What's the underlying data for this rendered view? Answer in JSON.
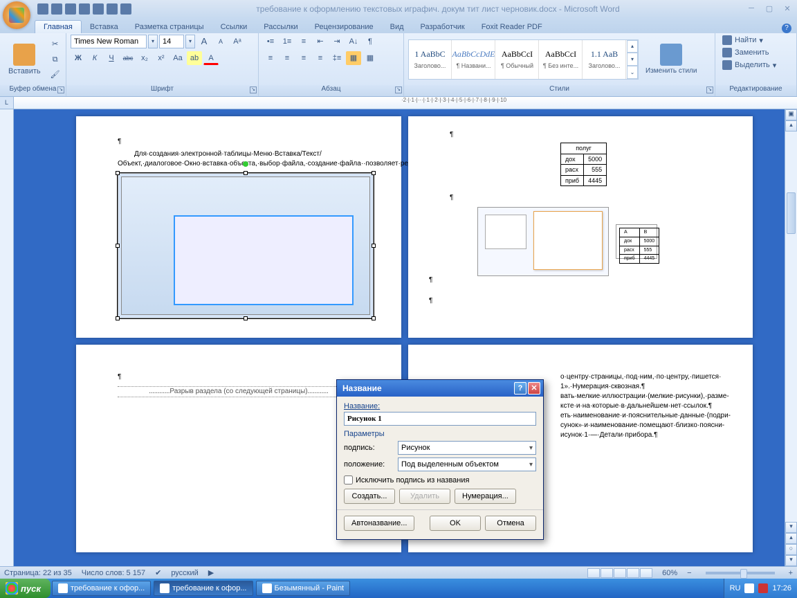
{
  "titlebar": {
    "document_title": "требование к оформлению текстовых играфич. докум  тит лист черновик.docx - Microsoft Word"
  },
  "tabs": {
    "items": [
      "Главная",
      "Вставка",
      "Разметка страницы",
      "Ссылки",
      "Рассылки",
      "Рецензирование",
      "Вид",
      "Разработчик",
      "Foxit Reader PDF"
    ],
    "active": 0
  },
  "ribbon": {
    "clipboard": {
      "label": "Буфер обмена",
      "paste": "Вставить"
    },
    "font": {
      "label": "Шрифт",
      "name": "Times New Roman",
      "size": "14",
      "bold": "Ж",
      "italic": "К",
      "underline": "Ч",
      "strike": "abc",
      "sub": "x₂",
      "sup": "x²",
      "case": "Aa",
      "grow": "A",
      "shrink": "A",
      "clear": "A"
    },
    "paragraph": {
      "label": "Абзац"
    },
    "styles": {
      "label": "Стили",
      "items": [
        {
          "preview": "1  AaBbC",
          "name": "Заголово..."
        },
        {
          "preview": "AaBbCcDdE",
          "name": "¶ Названи..."
        },
        {
          "preview": "AaBbCcI",
          "name": "¶ Обычный"
        },
        {
          "preview": "AaBbCcI",
          "name": "¶ Без инте..."
        },
        {
          "preview": "1.1  AaB",
          "name": "Заголово..."
        }
      ],
      "change": "Изменить стили"
    },
    "editing": {
      "label": "Редактирование",
      "find": "Найти",
      "replace": "Заменить",
      "select": "Выделить"
    }
  },
  "document": {
    "page1_text": "Для·создания·электронной·таблицы·Меню·Вставка/Текст/Объект,·диалоговое·Окно·вставка·объекта,·выбор·файла,·создание·файла··позволяет·редактировать·данные·в·электронной·таблице,·вносить·правки.¶",
    "page3_break": "Разрыв раздела (со следующей страницы)",
    "page2_table": {
      "header": "полуг",
      "rows": [
        [
          "дох",
          "5000"
        ],
        [
          "расх",
          "555"
        ],
        [
          "приб",
          "4445"
        ]
      ]
    },
    "page4_lines": [
      "о·центру·страницы,·под·ним,·по·центру,·пишется·",
      "1».·Нумерация·сквозная.¶",
      "вать·мелкие·иллюстрации·(мелкие·рисунки),·разме-",
      "ксте·и·на·которые·в·дальнейшем·нет·ссылок.¶",
      "еть·наименование·и·пояснительные·данные·(подри-",
      "сунок»·и·наименование·помещают·близко·поясни-",
      "исунок·1·—·Детали·прибора.¶"
    ]
  },
  "dialog": {
    "title": "Название",
    "name_label": "Название:",
    "name_value": "Рисунок 1",
    "params": "Параметры",
    "caption_label": "подпись:",
    "caption_value": "Рисунок",
    "position_label": "положение:",
    "position_value": "Под выделенным объектом",
    "exclude": "Исключить подпись из названия",
    "create": "Создать...",
    "delete": "Удалить",
    "numbering": "Нумерация...",
    "autocaption": "Автоназвание...",
    "ok": "OK",
    "cancel": "Отмена"
  },
  "statusbar": {
    "page": "Страница: 22 из 35",
    "words": "Число слов: 5 157",
    "language": "русский",
    "zoom": "60%"
  },
  "taskbar": {
    "start": "пуск",
    "items": [
      "требование  к офор...",
      "требование к офор...",
      "Безымянный - Paint"
    ],
    "lang": "RU",
    "time": "17:26"
  },
  "chart_data": {
    "type": "table",
    "title": "полуг",
    "rows": [
      {
        "label": "дох",
        "value": 5000
      },
      {
        "label": "расх",
        "value": 555
      },
      {
        "label": "приб",
        "value": 4445
      }
    ]
  }
}
